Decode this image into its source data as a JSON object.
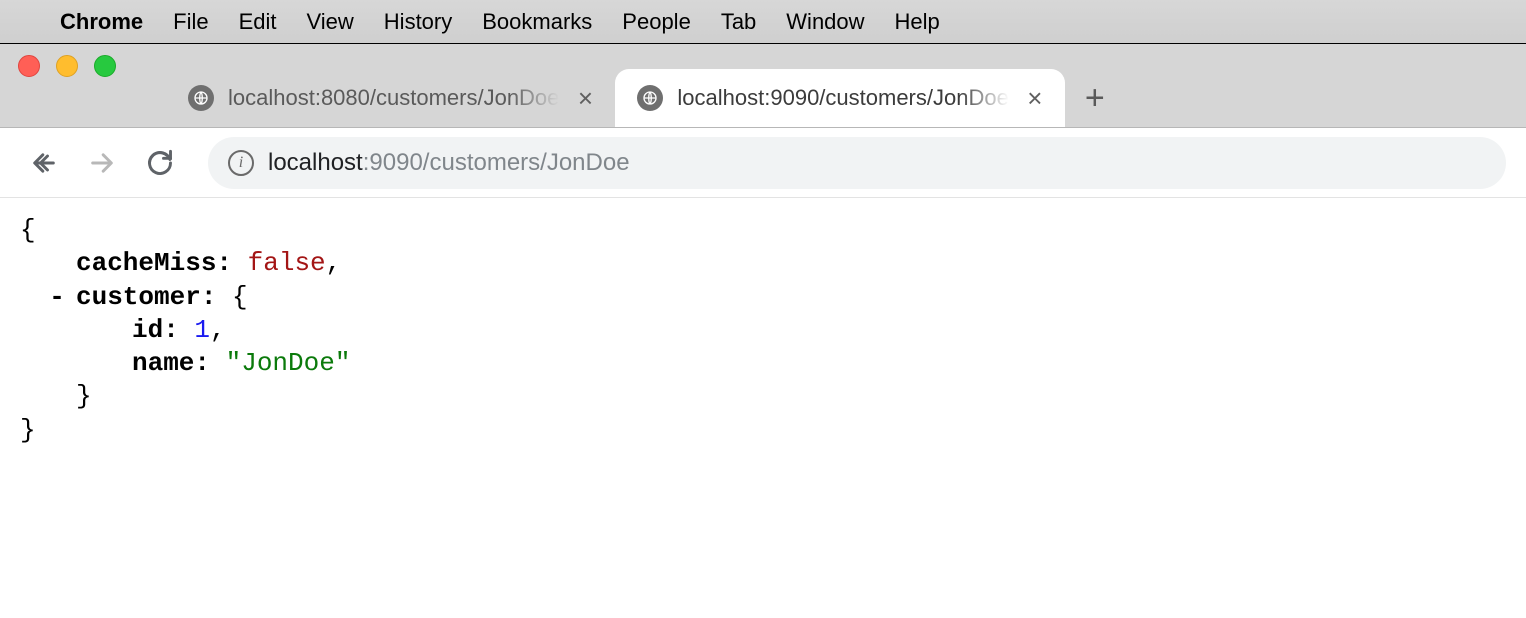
{
  "menubar": {
    "app": "Chrome",
    "items": [
      "File",
      "Edit",
      "View",
      "History",
      "Bookmarks",
      "People",
      "Tab",
      "Window",
      "Help"
    ]
  },
  "tabs": [
    {
      "title": "localhost:8080/customers/JonDoe",
      "active": false
    },
    {
      "title": "localhost:9090/customers/JonDoe",
      "active": true
    }
  ],
  "address": {
    "host": "localhost",
    "port": ":9090",
    "path": "/customers/JonDoe"
  },
  "json": {
    "brace_open": "{",
    "brace_close": "}",
    "cacheMiss_key": "cacheMiss:",
    "cacheMiss_val": "false",
    "customer_key": "customer:",
    "id_key": "id:",
    "id_val": "1",
    "name_key": "name:",
    "name_val": "\"JonDoe\"",
    "comma": ",",
    "expander": "-"
  }
}
